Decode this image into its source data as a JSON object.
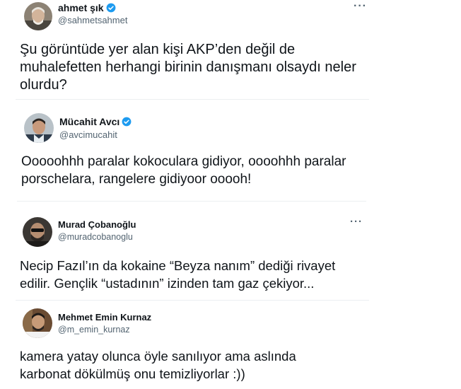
{
  "tweets": [
    {
      "name": "ahmet şık",
      "handle": "@sahmetsahmet",
      "verified": true,
      "avatar_icon": "avatar-photo-ahmet",
      "more_icon": "more-options-icon",
      "more_label": "···",
      "lines": [
        "Şu görüntüde yer alan kişi AKP’den değil de",
        "muhalefetten herhangi birinin danışmanı olsaydı neler",
        "olurdu?"
      ]
    },
    {
      "name": "Mücahit Avcı",
      "handle": "@avcimucahit",
      "verified": true,
      "avatar_icon": "avatar-photo-mucahit",
      "lines": [
        "Ooooohhh paralar kokoculara gidiyor, oooohhh paralar",
        "porschelara, rangelere gidiyoor ooooh!"
      ]
    },
    {
      "name": "Murad Çobanoğlu",
      "handle": "@muradcobanoglu",
      "verified": false,
      "avatar_icon": "avatar-photo-murad",
      "more_icon": "more-options-icon",
      "more_label": "···",
      "lines": [
        "Necip Fazıl’ın da kokaine “Beyza nanım” dediği rivayet",
        "edilir. Gençlik “ustadının” izinden tam gaz çekiyor..."
      ]
    },
    {
      "name": "Mehmet Emin Kurnaz",
      "handle": "@m_emin_kurnaz",
      "verified": false,
      "avatar_icon": "avatar-photo-mehmet",
      "lines": [
        "kamera yatay olunca öyle sanılıyor ama aslında",
        "karbonat dökülmüş onu temizliyorlar :))"
      ]
    }
  ],
  "colors": {
    "verified_badge": "#1d9bf0",
    "handle": "#536471",
    "text": "#0f1419",
    "divider": "#eceff1"
  }
}
